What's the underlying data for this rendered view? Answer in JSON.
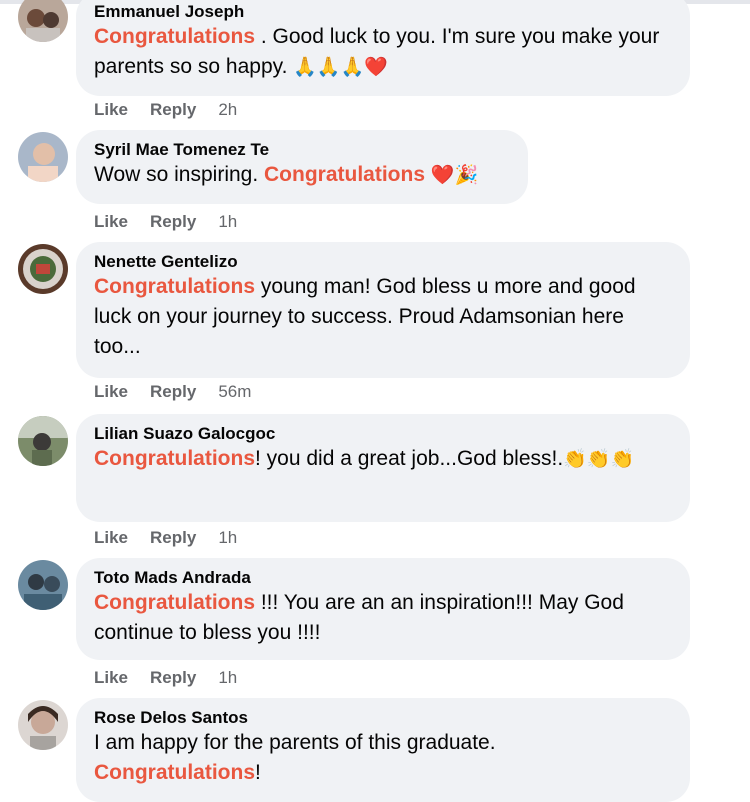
{
  "comments": [
    {
      "author": "Emmanuel Joseph",
      "highlight": "Congratulations",
      "text": " . Good luck to you. I'm sure you make your parents so so happy. ",
      "emoji": "🙏🙏🙏❤️",
      "time": "2h"
    },
    {
      "author": "Syril Mae Tomenez Te",
      "pre": "Wow so inspiring. ",
      "highlight": "Congratulations",
      "text": " ",
      "emoji": "❤️🎉",
      "time": "1h"
    },
    {
      "author": "Nenette Gentelizo",
      "highlight": "Congratulations",
      "text": " young man! God bless u more and good luck on your journey to success. Proud Adamsonian here too...",
      "time": "56m"
    },
    {
      "author": "Lilian Suazo Galocgoc",
      "highlight": "Congratulations",
      "text": "! you did a great job...God bless!.",
      "emoji": "👏👏👏",
      "time": "1h"
    },
    {
      "author": "Toto Mads Andrada",
      "highlight": "Congratulations",
      "text": " !!! You are an an inspiration!!! May God continue to bless you !!!!",
      "time": "1h"
    },
    {
      "author": "Rose Delos Santos",
      "pre": "I am happy for the parents of this graduate. ",
      "highlight": "Congratulations",
      "text": "!"
    }
  ],
  "actions": {
    "like": "Like",
    "reply": "Reply"
  },
  "colors": {
    "highlight": "#e9573f",
    "bubble": "#f0f2f5",
    "meta": "#65676b"
  }
}
